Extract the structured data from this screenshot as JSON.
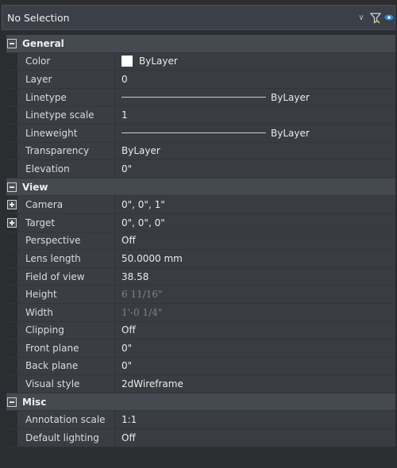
{
  "header": {
    "selection": "No Selection"
  },
  "groups": [
    {
      "title": "General",
      "rows": [
        {
          "label": "Color",
          "value": "ByLayer",
          "swatch": "#ffffff"
        },
        {
          "label": "Layer",
          "value": "0"
        },
        {
          "label": "Linetype",
          "value": "ByLayer"
        },
        {
          "label": "Linetype scale",
          "value": "1"
        },
        {
          "label": "Lineweight",
          "value": "ByLayer"
        },
        {
          "label": "Transparency",
          "value": "ByLayer"
        },
        {
          "label": "Elevation",
          "value": "0\""
        }
      ]
    },
    {
      "title": "View",
      "rows": [
        {
          "label": "Camera",
          "value": "0\", 0\", 1\""
        },
        {
          "label": "Target",
          "value": "0\", 0\", 0\""
        },
        {
          "label": "Perspective",
          "value": "Off"
        },
        {
          "label": "Lens length",
          "value": "50.0000 mm"
        },
        {
          "label": "Field of view",
          "value": "38.58"
        },
        {
          "label": "Height",
          "value": "6 11/16\""
        },
        {
          "label": "Width",
          "value": "1'-0 1/4\""
        },
        {
          "label": "Clipping",
          "value": "Off"
        },
        {
          "label": "Front plane",
          "value": "0\""
        },
        {
          "label": "Back plane",
          "value": "0\""
        },
        {
          "label": "Visual style",
          "value": "2dWireframe"
        }
      ]
    },
    {
      "title": "Misc",
      "rows": [
        {
          "label": "Annotation scale",
          "value": "1:1"
        },
        {
          "label": "Default lighting",
          "value": "Off"
        }
      ]
    }
  ]
}
